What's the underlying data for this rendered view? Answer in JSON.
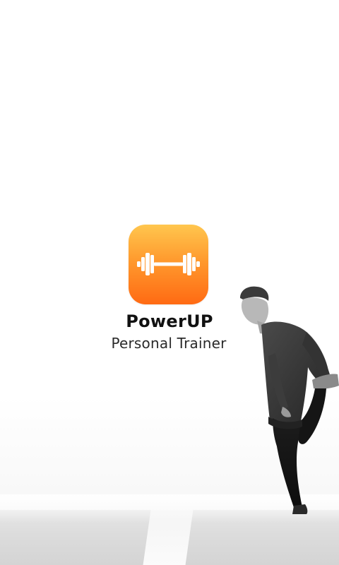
{
  "app": {
    "name": "PowerUP",
    "tagline": "Personal Trainer",
    "icon": "dumbbell-icon"
  },
  "colors": {
    "icon_gradient_top": "#ffc64e",
    "icon_gradient_bottom": "#ff6a13",
    "background": "#ffffff",
    "title": "#111111"
  },
  "background_image": "athlete-stretching-photo"
}
